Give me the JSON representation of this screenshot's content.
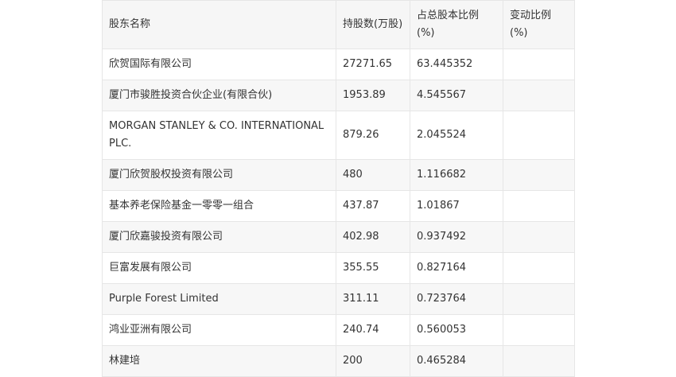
{
  "table": {
    "headers": [
      "股东名称",
      "持股数(万股)",
      "占总股本比例(%)",
      "变动比例(%)"
    ],
    "rows": [
      [
        "欣贺国际有限公司",
        "27271.65",
        "63.445352",
        ""
      ],
      [
        "厦门市骏胜投资合伙企业(有限合伙)",
        "1953.89",
        "4.545567",
        ""
      ],
      [
        "MORGAN STANLEY & CO. INTERNATIONAL PLC.",
        "879.26",
        "2.045524",
        ""
      ],
      [
        "厦门欣贺股权投资有限公司",
        "480",
        "1.116682",
        ""
      ],
      [
        "基本养老保险基金一零零一组合",
        "437.87",
        "1.01867",
        ""
      ],
      [
        "厦门欣嘉骏投资有限公司",
        "402.98",
        "0.937492",
        ""
      ],
      [
        "巨富发展有限公司",
        "355.55",
        "0.827164",
        ""
      ],
      [
        "Purple Forest Limited",
        "311.11",
        "0.723764",
        ""
      ],
      [
        "鸿业亚洲有限公司",
        "240.74",
        "0.560053",
        ""
      ],
      [
        "林建培",
        "200",
        "0.465284",
        ""
      ]
    ]
  }
}
